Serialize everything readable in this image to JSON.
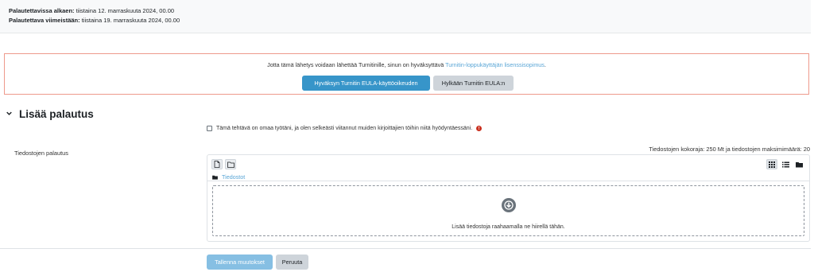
{
  "dates": {
    "start_label": "Palautettavissa alkaen:",
    "start_value": "tiistaina 12. marraskuuta 2024, 00.00",
    "due_label": "Palautettava viimeistään:",
    "due_value": "tiistaina 19. marraskuuta 2024, 00.00"
  },
  "eula": {
    "text": "Jotta tämä lähetys voidaan lähettää Turnitinille, sinun on hyväksyttävä",
    "link": "Turnitin-loppukäyttäjän lisenssisopimus",
    "text_end": ".",
    "accept_label": "Hyväksyn Turnitin EULA-käyttöoikeuden",
    "decline_label": "Hylkään Turnitin EULA:n"
  },
  "section": {
    "title": "Lisää palautus"
  },
  "declaration": {
    "text": "Tämä tehtävä on omaa työtäni, ja olen selkeästi viitannut muiden kirjoittajien töihin niitä hyödyntäessäni.",
    "required_icon": "exclamation-circle-icon"
  },
  "files": {
    "label": "Tiedostojen palautus",
    "limits": "Tiedostojen kokoraja: 250 Mt ja tiedostojen maksimimäärä: 20",
    "path_folder": "Tiedostot",
    "drop_text": "Lisää tiedostoja raahaamalla ne hiirellä tähän.",
    "icons": [
      "add-file-icon",
      "create-folder-icon",
      "grid-view-icon",
      "list-view-icon",
      "tree-view-icon",
      "folder-icon",
      "download-arrow-icon"
    ]
  },
  "actions": {
    "save_label": "Tallenna muutokset",
    "cancel_label": "Peruuta"
  },
  "colors": {
    "primary": "#3795c9",
    "primary_disabled": "#86bfe3",
    "link": "#5aa6d6",
    "danger": "#ca3120",
    "eula_border": "#ee9a8c"
  }
}
